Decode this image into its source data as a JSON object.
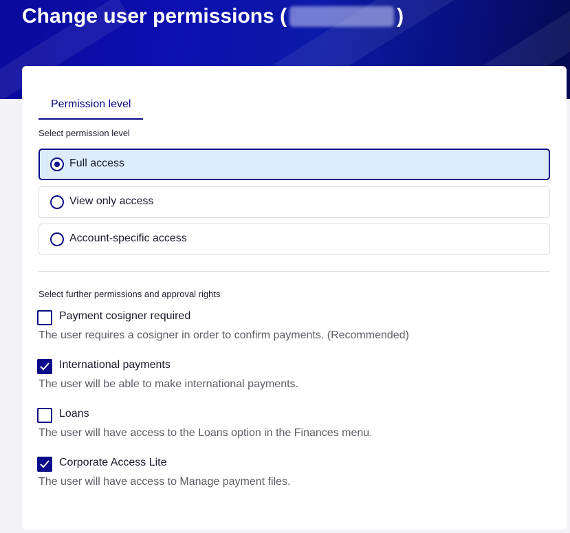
{
  "header": {
    "title_prefix": "Change user permissions (",
    "title_suffix": ")"
  },
  "tabs": [
    {
      "label": "Permission level",
      "active": true
    }
  ],
  "permission_level": {
    "label": "Select permission level",
    "options": [
      {
        "label": "Full access",
        "selected": true
      },
      {
        "label": "View only access",
        "selected": false
      },
      {
        "label": "Account-specific access",
        "selected": false
      }
    ]
  },
  "further_permissions": {
    "label": "Select further permissions and approval rights",
    "items": [
      {
        "label": "Payment cosigner required",
        "description": "The user requires a cosigner in order to confirm payments. (Recommended)",
        "checked": false
      },
      {
        "label": "International payments",
        "description": "The user will be able to make international payments.",
        "checked": true
      },
      {
        "label": "Loans",
        "description": "The user will have access to the Loans option in the Finances menu.",
        "checked": false
      },
      {
        "label": "Corporate Access Lite",
        "description": "The user will have access to Manage payment files.",
        "checked": true
      }
    ]
  },
  "colors": {
    "accent": "#0a0a8a",
    "selected_bg": "#dcecfb",
    "header_bg": "#0d0fb0"
  }
}
